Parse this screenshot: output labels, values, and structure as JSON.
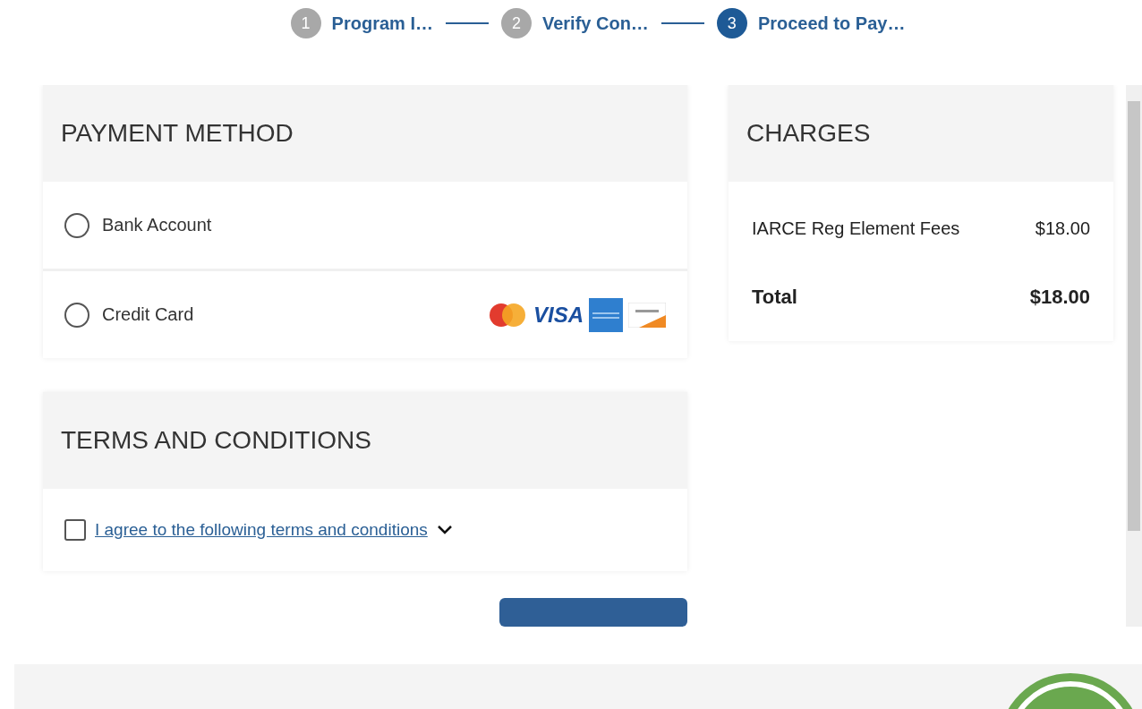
{
  "steps": [
    {
      "number": "1",
      "label": "Program I…",
      "selected": false
    },
    {
      "number": "2",
      "label": "Verify Con…",
      "selected": false
    },
    {
      "number": "3",
      "label": "Proceed to Pay…",
      "selected": true
    }
  ],
  "payment_method": {
    "title": "PAYMENT METHOD",
    "options": [
      {
        "label": "Bank Account",
        "selected": false,
        "cards": false
      },
      {
        "label": "Credit Card",
        "selected": false,
        "cards": true
      }
    ],
    "visa_text": "VISA"
  },
  "terms": {
    "title": "TERMS AND CONDITIONS",
    "checked": false,
    "link": "I agree to the following terms and conditions"
  },
  "charges": {
    "title": "CHARGES",
    "items": [
      {
        "name": "IARCE Reg Element Fees",
        "amount": "$18.00"
      }
    ],
    "total_label": "Total",
    "total_amount": "$18.00"
  }
}
